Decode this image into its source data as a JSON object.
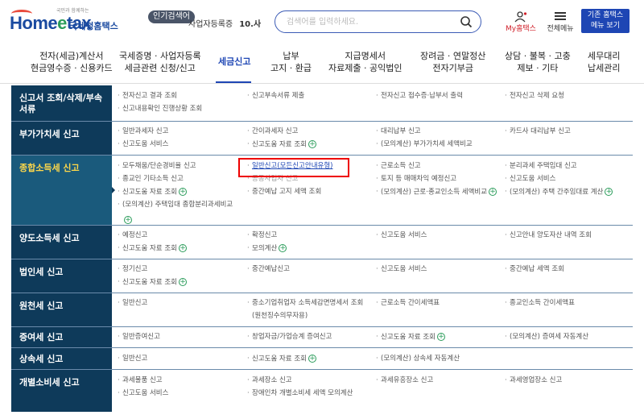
{
  "header": {
    "logo_tag": "국민과 함께하는",
    "logo_main_pre": "Home",
    "logo_main_e": "e",
    "logo_main_post": "tax",
    "logo_sub": "국세청홈택스",
    "popular_label": "인기검색어",
    "popular_rank_text": "사업자등록증",
    "popular_rank_num": "10.사",
    "search_placeholder": "검색어를 입력하세요.",
    "mytax_label": "My홈택스",
    "allmenu_label": "전체메뉴",
    "classic_line1": "기존 홈택스",
    "classic_line2": "메뉴 보기"
  },
  "gnb": [
    {
      "l1": "전자(세금)계산서",
      "l2": "현금영수증 · 신용카드"
    },
    {
      "l1": "국세증명 · 사업자등록",
      "l2": "세금관련 신청/신고"
    },
    {
      "l1": "세금신고",
      "l2": ""
    },
    {
      "l1": "납부",
      "l2": "고지 · 환급"
    },
    {
      "l1": "지급명세서",
      "l2": "자료제출 · 공익법인"
    },
    {
      "l1": "장려금 · 연말정산",
      "l2": "전자기부금"
    },
    {
      "l1": "상담 · 불복 · 고충",
      "l2": "제보 · 기타"
    },
    {
      "l1": "세무대리",
      "l2": "납세관리"
    }
  ],
  "rows": [
    {
      "head": "신고서 조회/삭제/부속서류",
      "items": [
        "전자신고 결과 조회",
        "신고부속서류 제출",
        "전자신고 접수증·납부서 출력",
        "전자신고 삭제 요청",
        "신고내용확인 진행상황 조회"
      ]
    },
    {
      "head": "부가가치세 신고",
      "items": [
        "일반과세자 신고",
        "간이과세자 신고",
        "대리납부 신고",
        "카드사 대리납부 신고",
        "신고도움 서비스",
        "신고도움 자료 조회",
        "(모의계산) 부가가치세 세액비교"
      ]
    },
    {
      "head": "종합소득세 신고",
      "items": [
        "모두채움/단순경비율 신고",
        "일반신고(모든신고안내유형)",
        "근로소득 신고",
        "분리과세 주택임대 신고",
        "종교인 기타소득 신고",
        "공동사업자 신고",
        "토지 등 매매차익 예정신고",
        "신고도움 서비스",
        "신고도움 자료 조회",
        "중간예납 고지 세액 조회",
        "(모의계산) 근로·종교인소득 세액비교",
        "(모의계산) 주택 간주임대료 계산",
        "(모의계산) 주택임대 종합분리과세비교"
      ]
    },
    {
      "head": "양도소득세 신고",
      "items": [
        "예정신고",
        "확정신고",
        "신고도움 서비스",
        "신고안내 양도자산 내역 조회",
        "신고도움 자료 조회",
        "모의계산"
      ]
    },
    {
      "head": "법인세 신고",
      "items": [
        "정기신고",
        "중간예납신고",
        "신고도움 서비스",
        "중간예납 세액 조회",
        "신고도움 자료 조회"
      ]
    },
    {
      "head": "원천세 신고",
      "items": [
        "일반신고",
        "중소기업취업자 소득세감면명세서 조회",
        "(원천징수의무자용)",
        "근로소득 간이세액표",
        "종교인소득 간이세액표"
      ]
    },
    {
      "head": "증여세 신고",
      "items": [
        "일반증여신고",
        "창업자금/가업승계 증여신고",
        "신고도움 자료 조회",
        "(모의계산) 증여세 자동계산"
      ]
    },
    {
      "head": "상속세 신고",
      "items": [
        "일반신고",
        "신고도움 자료 조회",
        "(모의계산) 상속세 자동계산"
      ]
    },
    {
      "head": "개별소비세 신고",
      "items": [
        "과세물품 신고",
        "과세장소 신고",
        "과세유흥장소 신고",
        "과세영업장소 신고",
        "신고도움 서비스",
        "장애인차 개별소비세 세액 모의계산"
      ]
    }
  ],
  "colors": {
    "navy": "#0e3a5a",
    "accent": "#1e46b4",
    "highlight": "#ff0000",
    "plus": "#2a9c5a"
  }
}
